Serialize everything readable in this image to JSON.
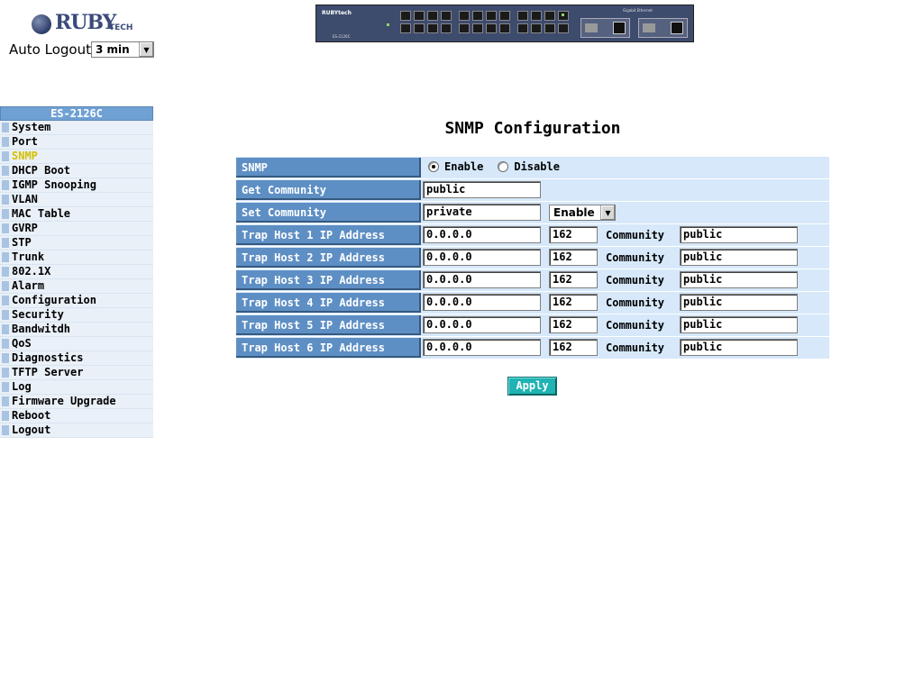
{
  "logo": {
    "text": "RUBY",
    "sub": "TECH"
  },
  "auto_logout": {
    "label": "Auto Logout",
    "value": "3 min"
  },
  "device": {
    "brand": "RUBYtech",
    "model": "ES-2126C",
    "gbe_label": "Gigabit Ethernet"
  },
  "sidebar": {
    "title": "ES-2126C",
    "items": [
      {
        "label": "System"
      },
      {
        "label": "Port"
      },
      {
        "label": "SNMP"
      },
      {
        "label": "DHCP Boot"
      },
      {
        "label": "IGMP Snooping"
      },
      {
        "label": "VLAN"
      },
      {
        "label": "MAC Table"
      },
      {
        "label": "GVRP"
      },
      {
        "label": "STP"
      },
      {
        "label": "Trunk"
      },
      {
        "label": "802.1X"
      },
      {
        "label": "Alarm"
      },
      {
        "label": "Configuration"
      },
      {
        "label": "Security"
      },
      {
        "label": "Bandwitdh"
      },
      {
        "label": "QoS"
      },
      {
        "label": "Diagnostics"
      },
      {
        "label": "TFTP Server"
      },
      {
        "label": "Log"
      },
      {
        "label": "Firmware Upgrade"
      },
      {
        "label": "Reboot"
      },
      {
        "label": "Logout"
      }
    ],
    "active_index": 2
  },
  "page": {
    "title": "SNMP Configuration",
    "snmp": {
      "label": "SNMP",
      "enable": "Enable",
      "disable": "Disable",
      "selected": "Enable"
    },
    "get_community": {
      "label": "Get Community",
      "value": "public"
    },
    "set_community": {
      "label": "Set Community",
      "value": "private",
      "mode": "Enable"
    },
    "community_label": "Community",
    "trap_hosts": [
      {
        "label": "Trap Host 1 IP Address",
        "ip": "0.0.0.0",
        "port": "162",
        "community": "public"
      },
      {
        "label": "Trap Host 2 IP Address",
        "ip": "0.0.0.0",
        "port": "162",
        "community": "public"
      },
      {
        "label": "Trap Host 3 IP Address",
        "ip": "0.0.0.0",
        "port": "162",
        "community": "public"
      },
      {
        "label": "Trap Host 4 IP Address",
        "ip": "0.0.0.0",
        "port": "162",
        "community": "public"
      },
      {
        "label": "Trap Host 5 IP Address",
        "ip": "0.0.0.0",
        "port": "162",
        "community": "public"
      },
      {
        "label": "Trap Host 6 IP Address",
        "ip": "0.0.0.0",
        "port": "162",
        "community": "public"
      }
    ],
    "apply_label": "Apply"
  },
  "colors": {
    "label_bg": "#5e8fc4",
    "row_bg": "#d6e8fa",
    "apply_bg": "#1fb3b3",
    "active_menu": "#d4c000"
  }
}
